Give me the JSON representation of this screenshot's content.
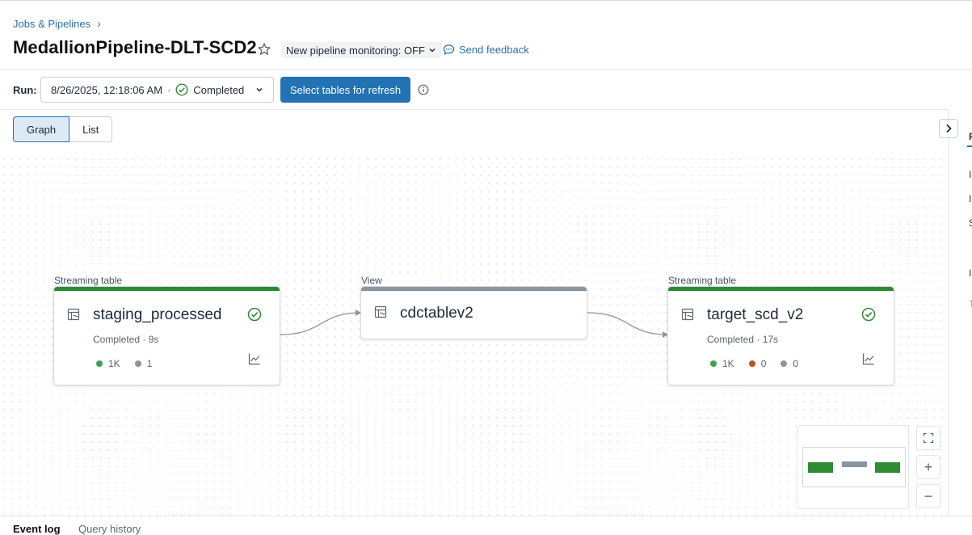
{
  "breadcrumb": {
    "root": "Jobs & Pipelines",
    "separator": "›"
  },
  "page": {
    "title": "MedallionPipeline-DLT-SCD2"
  },
  "header": {
    "monitoring_label": "New pipeline monitoring: OFF",
    "feedback_label": "Send feedback"
  },
  "run": {
    "label": "Run:",
    "timestamp": "8/26/2025, 12:18:06 AM",
    "dot": "·",
    "status": "Completed",
    "refresh_button": "Select tables for refresh"
  },
  "view_toggle": {
    "graph": "Graph",
    "list": "List",
    "selected": "Graph"
  },
  "side_panel": {
    "letters": [
      "P",
      "I",
      "I",
      "S",
      "I",
      "T"
    ]
  },
  "nodes": [
    {
      "type_label": "Streaming table",
      "name": "staging_processed",
      "status": "Completed · 9s",
      "accent": "#2e8b32",
      "metrics": [
        {
          "color": "#3fa34d",
          "value": "1K"
        },
        {
          "color": "#8a95a0",
          "value": "1"
        }
      ]
    },
    {
      "type_label": "View",
      "name": "cdctablev2",
      "accent": "#8a95a0"
    },
    {
      "type_label": "Streaming table",
      "name": "target_scd_v2",
      "status": "Completed · 17s",
      "accent": "#2e8b32",
      "metrics": [
        {
          "color": "#3fa34d",
          "value": "1K"
        },
        {
          "color": "#c0501f",
          "value": "0"
        },
        {
          "color": "#8a95a0",
          "value": "0"
        }
      ]
    }
  ],
  "zoom": {
    "plus": "+",
    "minus": "−"
  },
  "bottom_tabs": {
    "event_log": "Event log",
    "query_history": "Query history"
  },
  "colors": {
    "primary": "#2272b4",
    "success": "#2e8b32",
    "link": "#2a6fb0"
  }
}
